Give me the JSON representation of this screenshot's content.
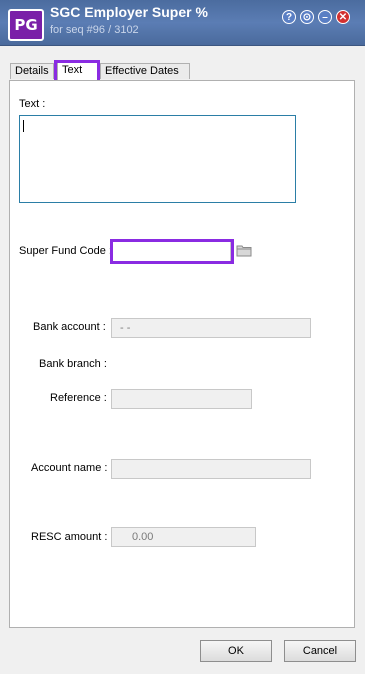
{
  "window": {
    "logo": "PG",
    "title": "SGC Employer Super %",
    "subtitle": "for seq #96 / 3102",
    "help": "?",
    "options": "⊙",
    "minimize": "–",
    "close": "✕"
  },
  "tabs": [
    {
      "label": "Details"
    },
    {
      "label": "Text"
    },
    {
      "label": "Effective Dates"
    }
  ],
  "form": {
    "text_label": "Text :",
    "text_value": "",
    "super_fund_label": "Super Fund Code :",
    "super_fund_value": "",
    "bank_account_label": "Bank account :",
    "bank_account_value": "-   -",
    "bank_branch_label": "Bank branch :",
    "reference_label": "Reference :",
    "reference_value": "",
    "account_name_label": "Account name :",
    "account_name_value": "",
    "resc_label": "RESC amount :",
    "resc_value": "0.00"
  },
  "buttons": {
    "ok": "OK",
    "cancel": "Cancel"
  }
}
